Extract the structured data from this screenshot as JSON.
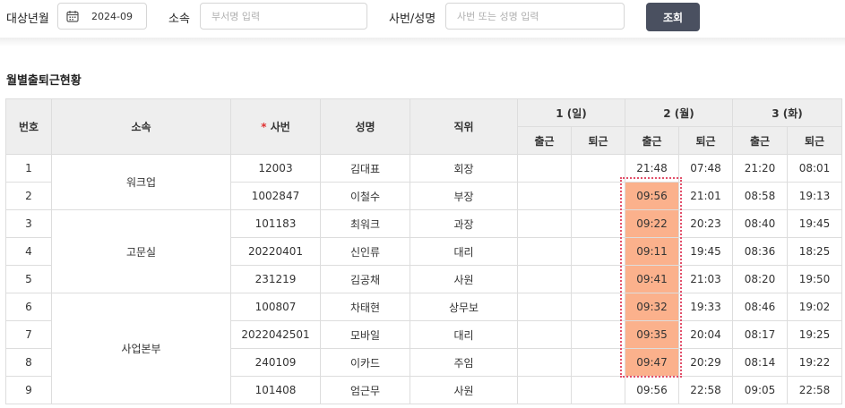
{
  "filters": {
    "month_label": "대상년월",
    "month_value": "2024-09",
    "dept_label": "소속",
    "dept_placeholder": "부서명 입력",
    "emp_label": "사번/성명",
    "emp_placeholder": "사번 또는 성명 입력",
    "search_button": "조회"
  },
  "section_title": "월별출퇴근현황",
  "table": {
    "headers": {
      "no": "번호",
      "dept": "소속",
      "required_mark": "*",
      "emp_id": "사번",
      "name": "성명",
      "position": "직위",
      "in": "출근",
      "out": "퇴근"
    },
    "days": [
      {
        "label": "1 (일)",
        "weekend": true
      },
      {
        "label": "2 (월)",
        "weekend": false
      },
      {
        "label": "3 (화)",
        "weekend": false
      }
    ],
    "groups": [
      {
        "dept": "워크업",
        "rows": [
          {
            "no": "1",
            "emp_id": "12003",
            "name": "김대표",
            "position": "회장",
            "times": [
              "",
              "",
              "21:48",
              "07:48",
              "21:20",
              "08:01"
            ]
          },
          {
            "no": "2",
            "emp_id": "1002847",
            "name": "이철수",
            "position": "부장",
            "times": [
              "",
              "",
              "09:56",
              "21:01",
              "08:58",
              "19:13"
            ]
          }
        ]
      },
      {
        "dept": "고문실",
        "rows": [
          {
            "no": "3",
            "emp_id": "101183",
            "name": "최워크",
            "position": "과장",
            "times": [
              "",
              "",
              "09:22",
              "20:23",
              "08:40",
              "19:45"
            ]
          },
          {
            "no": "4",
            "emp_id": "20220401",
            "name": "신인류",
            "position": "대리",
            "times": [
              "",
              "",
              "09:11",
              "19:45",
              "08:36",
              "18:25"
            ]
          },
          {
            "no": "5",
            "emp_id": "231219",
            "name": "김공채",
            "position": "사원",
            "times": [
              "",
              "",
              "09:41",
              "21:03",
              "08:20",
              "19:50"
            ]
          }
        ]
      },
      {
        "dept": "사업본부",
        "rows": [
          {
            "no": "6",
            "emp_id": "100807",
            "name": "차태현",
            "position": "상무보",
            "times": [
              "",
              "",
              "09:32",
              "19:33",
              "08:46",
              "19:02"
            ]
          },
          {
            "no": "7",
            "emp_id": "2022042501",
            "name": "모바일",
            "position": "대리",
            "times": [
              "",
              "",
              "09:35",
              "20:04",
              "08:17",
              "19:25"
            ]
          },
          {
            "no": "8",
            "emp_id": "240109",
            "name": "이카드",
            "position": "주임",
            "times": [
              "",
              "",
              "09:47",
              "20:29",
              "08:14",
              "19:22"
            ]
          },
          {
            "no": "9",
            "emp_id": "101408",
            "name": "엄근무",
            "position": "사원",
            "times": [
              "",
              "",
              "09:56",
              "22:58",
              "09:05",
              "22:58"
            ]
          }
        ]
      }
    ],
    "highlight": {
      "column_index": 2,
      "rows": [
        "2",
        "3",
        "4",
        "5",
        "6",
        "7",
        "8"
      ],
      "fill": "#fbb18c",
      "border": "#e2506a"
    }
  },
  "colors": {
    "button": "#4a5060",
    "weekend": "#e03131",
    "header_bg": "#eeeeee"
  },
  "icons": {
    "date_picker": "calendar-icon"
  }
}
